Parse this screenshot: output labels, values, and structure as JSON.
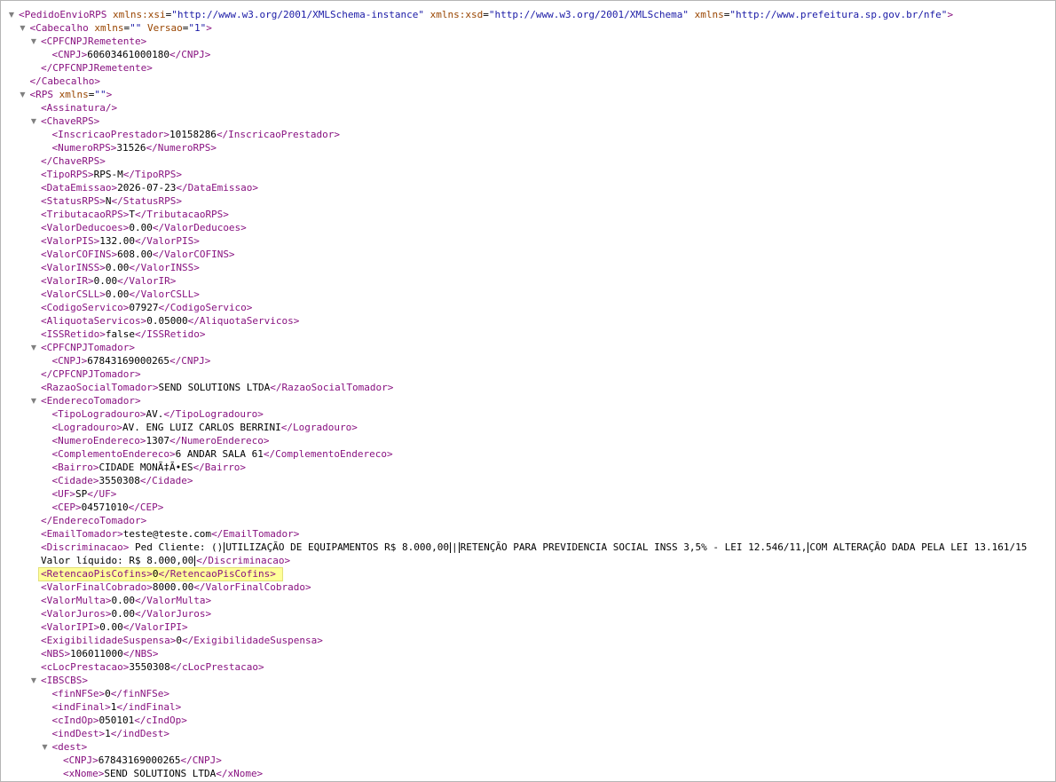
{
  "lines": [
    {
      "indent": 0,
      "toggle": true,
      "parts": [
        [
          "tag",
          "<PedidoEnvioRPS "
        ],
        [
          "attr",
          "xmlns:xsi"
        ],
        [
          "eq",
          "="
        ],
        [
          "val",
          "\"http://www.w3.org/2001/XMLSchema-instance\""
        ],
        [
          "txt",
          " "
        ],
        [
          "attr",
          "xmlns:xsd"
        ],
        [
          "eq",
          "="
        ],
        [
          "val",
          "\"http://www.w3.org/2001/XMLSchema\""
        ],
        [
          "txt",
          " "
        ],
        [
          "attr",
          "xmlns"
        ],
        [
          "eq",
          "="
        ],
        [
          "val",
          "\"http://www.prefeitura.sp.gov.br/nfe\""
        ],
        [
          "tag",
          ">"
        ]
      ]
    },
    {
      "indent": 1,
      "toggle": true,
      "parts": [
        [
          "tag",
          "<Cabecalho "
        ],
        [
          "attr",
          "xmlns"
        ],
        [
          "eq",
          "="
        ],
        [
          "val",
          "\"\""
        ],
        [
          "txt",
          " "
        ],
        [
          "attr",
          "Versao"
        ],
        [
          "eq",
          "="
        ],
        [
          "val",
          "\"1\""
        ],
        [
          "tag",
          ">"
        ]
      ]
    },
    {
      "indent": 2,
      "toggle": true,
      "parts": [
        [
          "tag",
          "<CPFCNPJRemetente>"
        ]
      ]
    },
    {
      "indent": 3,
      "parts": [
        [
          "tag",
          "<CNPJ>"
        ],
        [
          "txt",
          "60603461000180"
        ],
        [
          "tag",
          "</CNPJ>"
        ]
      ]
    },
    {
      "indent": 2,
      "parts": [
        [
          "tag",
          "</CPFCNPJRemetente>"
        ]
      ]
    },
    {
      "indent": 1,
      "parts": [
        [
          "tag",
          "</Cabecalho>"
        ]
      ]
    },
    {
      "indent": 1,
      "toggle": true,
      "parts": [
        [
          "tag",
          "<RPS "
        ],
        [
          "attr",
          "xmlns"
        ],
        [
          "eq",
          "="
        ],
        [
          "val",
          "\"\""
        ],
        [
          "tag",
          ">"
        ]
      ]
    },
    {
      "indent": 2,
      "parts": [
        [
          "tag",
          "<Assinatura/>"
        ]
      ]
    },
    {
      "indent": 2,
      "toggle": true,
      "parts": [
        [
          "tag",
          "<ChaveRPS>"
        ]
      ]
    },
    {
      "indent": 3,
      "parts": [
        [
          "tag",
          "<InscricaoPrestador>"
        ],
        [
          "txt",
          "10158286"
        ],
        [
          "tag",
          "</InscricaoPrestador>"
        ]
      ]
    },
    {
      "indent": 3,
      "parts": [
        [
          "tag",
          "<NumeroRPS>"
        ],
        [
          "txt",
          "31526"
        ],
        [
          "tag",
          "</NumeroRPS>"
        ]
      ]
    },
    {
      "indent": 2,
      "parts": [
        [
          "tag",
          "</ChaveRPS>"
        ]
      ]
    },
    {
      "indent": 2,
      "parts": [
        [
          "tag",
          "<TipoRPS>"
        ],
        [
          "txt",
          "RPS-M"
        ],
        [
          "tag",
          "</TipoRPS>"
        ]
      ]
    },
    {
      "indent": 2,
      "parts": [
        [
          "tag",
          "<DataEmissao>"
        ],
        [
          "txt",
          "2026-07-23"
        ],
        [
          "tag",
          "</DataEmissao>"
        ]
      ]
    },
    {
      "indent": 2,
      "parts": [
        [
          "tag",
          "<StatusRPS>"
        ],
        [
          "txt",
          "N"
        ],
        [
          "tag",
          "</StatusRPS>"
        ]
      ]
    },
    {
      "indent": 2,
      "parts": [
        [
          "tag",
          "<TributacaoRPS>"
        ],
        [
          "txt",
          "T"
        ],
        [
          "tag",
          "</TributacaoRPS>"
        ]
      ]
    },
    {
      "indent": 2,
      "parts": [
        [
          "tag",
          "<ValorDeducoes>"
        ],
        [
          "txt",
          "0.00"
        ],
        [
          "tag",
          "</ValorDeducoes>"
        ]
      ]
    },
    {
      "indent": 2,
      "parts": [
        [
          "tag",
          "<ValorPIS>"
        ],
        [
          "txt",
          "132.00"
        ],
        [
          "tag",
          "</ValorPIS>"
        ]
      ]
    },
    {
      "indent": 2,
      "parts": [
        [
          "tag",
          "<ValorCOFINS>"
        ],
        [
          "txt",
          "608.00"
        ],
        [
          "tag",
          "</ValorCOFINS>"
        ]
      ]
    },
    {
      "indent": 2,
      "parts": [
        [
          "tag",
          "<ValorINSS>"
        ],
        [
          "txt",
          "0.00"
        ],
        [
          "tag",
          "</ValorINSS>"
        ]
      ]
    },
    {
      "indent": 2,
      "parts": [
        [
          "tag",
          "<ValorIR>"
        ],
        [
          "txt",
          "0.00"
        ],
        [
          "tag",
          "</ValorIR>"
        ]
      ]
    },
    {
      "indent": 2,
      "parts": [
        [
          "tag",
          "<ValorCSLL>"
        ],
        [
          "txt",
          "0.00"
        ],
        [
          "tag",
          "</ValorCSLL>"
        ]
      ]
    },
    {
      "indent": 2,
      "parts": [
        [
          "tag",
          "<CodigoServico>"
        ],
        [
          "txt",
          "07927"
        ],
        [
          "tag",
          "</CodigoServico>"
        ]
      ]
    },
    {
      "indent": 2,
      "parts": [
        [
          "tag",
          "<AliquotaServicos>"
        ],
        [
          "txt",
          "0.05000"
        ],
        [
          "tag",
          "</AliquotaServicos>"
        ]
      ]
    },
    {
      "indent": 2,
      "parts": [
        [
          "tag",
          "<ISSRetido>"
        ],
        [
          "txt",
          "false"
        ],
        [
          "tag",
          "</ISSRetido>"
        ]
      ]
    },
    {
      "indent": 2,
      "toggle": true,
      "parts": [
        [
          "tag",
          "<CPFCNPJTomador>"
        ]
      ]
    },
    {
      "indent": 3,
      "parts": [
        [
          "tag",
          "<CNPJ>"
        ],
        [
          "txt",
          "67843169000265"
        ],
        [
          "tag",
          "</CNPJ>"
        ]
      ]
    },
    {
      "indent": 2,
      "parts": [
        [
          "tag",
          "</CPFCNPJTomador>"
        ]
      ]
    },
    {
      "indent": 2,
      "parts": [
        [
          "tag",
          "<RazaoSocialTomador>"
        ],
        [
          "txt",
          "SEND SOLUTIONS LTDA"
        ],
        [
          "tag",
          "</RazaoSocialTomador>"
        ]
      ]
    },
    {
      "indent": 2,
      "toggle": true,
      "parts": [
        [
          "tag",
          "<EnderecoTomador>"
        ]
      ]
    },
    {
      "indent": 3,
      "parts": [
        [
          "tag",
          "<TipoLogradouro>"
        ],
        [
          "txt",
          "AV."
        ],
        [
          "tag",
          "</TipoLogradouro>"
        ]
      ]
    },
    {
      "indent": 3,
      "parts": [
        [
          "tag",
          "<Logradouro>"
        ],
        [
          "txt",
          "AV. ENG LUIZ CARLOS BERRINI"
        ],
        [
          "tag",
          "</Logradouro>"
        ]
      ]
    },
    {
      "indent": 3,
      "parts": [
        [
          "tag",
          "<NumeroEndereco>"
        ],
        [
          "txt",
          "1307"
        ],
        [
          "tag",
          "</NumeroEndereco>"
        ]
      ]
    },
    {
      "indent": 3,
      "parts": [
        [
          "tag",
          "<ComplementoEndereco>"
        ],
        [
          "txt",
          "6 ANDAR SALA 61"
        ],
        [
          "tag",
          "</ComplementoEndereco>"
        ]
      ]
    },
    {
      "indent": 3,
      "parts": [
        [
          "tag",
          "<Bairro>"
        ],
        [
          "txt",
          "CIDADE MONÃ‡Ã•ES"
        ],
        [
          "tag",
          "</Bairro>"
        ]
      ]
    },
    {
      "indent": 3,
      "parts": [
        [
          "tag",
          "<Cidade>"
        ],
        [
          "txt",
          "3550308"
        ],
        [
          "tag",
          "</Cidade>"
        ]
      ]
    },
    {
      "indent": 3,
      "parts": [
        [
          "tag",
          "<UF>"
        ],
        [
          "txt",
          "SP"
        ],
        [
          "tag",
          "</UF>"
        ]
      ]
    },
    {
      "indent": 3,
      "parts": [
        [
          "tag",
          "<CEP>"
        ],
        [
          "txt",
          "04571010"
        ],
        [
          "tag",
          "</CEP>"
        ]
      ]
    },
    {
      "indent": 2,
      "parts": [
        [
          "tag",
          "</EnderecoTomador>"
        ]
      ]
    },
    {
      "indent": 2,
      "parts": [
        [
          "tag",
          "<EmailTomador>"
        ],
        [
          "txt",
          "teste@teste.com"
        ],
        [
          "tag",
          "</EmailTomador>"
        ]
      ]
    },
    {
      "indent": 2,
      "parts": [
        [
          "tag",
          "<Discriminacao>"
        ],
        [
          "txt",
          " Ped Cliente: ()"
        ],
        [
          "caret",
          ""
        ],
        [
          "txt",
          "UTILIZAÇÃO DE EQUIPAMENTOS R$ 8.000,00"
        ],
        [
          "caret",
          ""
        ],
        [
          "txt",
          "|"
        ],
        [
          "caret",
          ""
        ],
        [
          "txt",
          "RETENÇÃO PARA PREVIDENCIA SOCIAL INSS 3,5% - LEI 12.546/11,"
        ],
        [
          "caret",
          ""
        ],
        [
          "txt",
          "COM ALTERAÇÃO DADA PELA LEI 13.161/15"
        ]
      ]
    },
    {
      "indent": 2,
      "parts": [
        [
          "txt",
          "Valor líquido: R$ 8.000,00"
        ],
        [
          "caret",
          ""
        ],
        [
          "tag",
          "</Discriminacao>"
        ]
      ]
    },
    {
      "indent": 2,
      "highlight": true,
      "parts": [
        [
          "tag",
          "<RetencaoPisCofins>"
        ],
        [
          "txt",
          "0"
        ],
        [
          "tag",
          "</RetencaoPisCofins>"
        ]
      ]
    },
    {
      "indent": 2,
      "parts": [
        [
          "tag",
          "<ValorFinalCobrado>"
        ],
        [
          "txt",
          "8000.00"
        ],
        [
          "tag",
          "</ValorFinalCobrado>"
        ]
      ]
    },
    {
      "indent": 2,
      "parts": [
        [
          "tag",
          "<ValorMulta>"
        ],
        [
          "txt",
          "0.00"
        ],
        [
          "tag",
          "</ValorMulta>"
        ]
      ]
    },
    {
      "indent": 2,
      "parts": [
        [
          "tag",
          "<ValorJuros>"
        ],
        [
          "txt",
          "0.00"
        ],
        [
          "tag",
          "</ValorJuros>"
        ]
      ]
    },
    {
      "indent": 2,
      "parts": [
        [
          "tag",
          "<ValorIPI>"
        ],
        [
          "txt",
          "0.00"
        ],
        [
          "tag",
          "</ValorIPI>"
        ]
      ]
    },
    {
      "indent": 2,
      "parts": [
        [
          "tag",
          "<ExigibilidadeSuspensa>"
        ],
        [
          "txt",
          "0"
        ],
        [
          "tag",
          "</ExigibilidadeSuspensa>"
        ]
      ]
    },
    {
      "indent": 2,
      "parts": [
        [
          "tag",
          "<NBS>"
        ],
        [
          "txt",
          "106011000"
        ],
        [
          "tag",
          "</NBS>"
        ]
      ]
    },
    {
      "indent": 2,
      "parts": [
        [
          "tag",
          "<cLocPrestacao>"
        ],
        [
          "txt",
          "3550308"
        ],
        [
          "tag",
          "</cLocPrestacao>"
        ]
      ]
    },
    {
      "indent": 2,
      "toggle": true,
      "parts": [
        [
          "tag",
          "<IBSCBS>"
        ]
      ]
    },
    {
      "indent": 3,
      "parts": [
        [
          "tag",
          "<finNFSe>"
        ],
        [
          "txt",
          "0"
        ],
        [
          "tag",
          "</finNFSe>"
        ]
      ]
    },
    {
      "indent": 3,
      "parts": [
        [
          "tag",
          "<indFinal>"
        ],
        [
          "txt",
          "1"
        ],
        [
          "tag",
          "</indFinal>"
        ]
      ]
    },
    {
      "indent": 3,
      "parts": [
        [
          "tag",
          "<cIndOp>"
        ],
        [
          "txt",
          "050101"
        ],
        [
          "tag",
          "</cIndOp>"
        ]
      ]
    },
    {
      "indent": 3,
      "parts": [
        [
          "tag",
          "<indDest>"
        ],
        [
          "txt",
          "1"
        ],
        [
          "tag",
          "</indDest>"
        ]
      ]
    },
    {
      "indent": 3,
      "toggle": true,
      "parts": [
        [
          "tag",
          "<dest>"
        ]
      ]
    },
    {
      "indent": 4,
      "parts": [
        [
          "tag",
          "<CNPJ>"
        ],
        [
          "txt",
          "67843169000265"
        ],
        [
          "tag",
          "</CNPJ>"
        ]
      ]
    },
    {
      "indent": 4,
      "parts": [
        [
          "tag",
          "<xNome>"
        ],
        [
          "txt",
          "SEND SOLUTIONS LTDA"
        ],
        [
          "tag",
          "</xNome>"
        ]
      ]
    }
  ],
  "toggle_glyph": "▼"
}
